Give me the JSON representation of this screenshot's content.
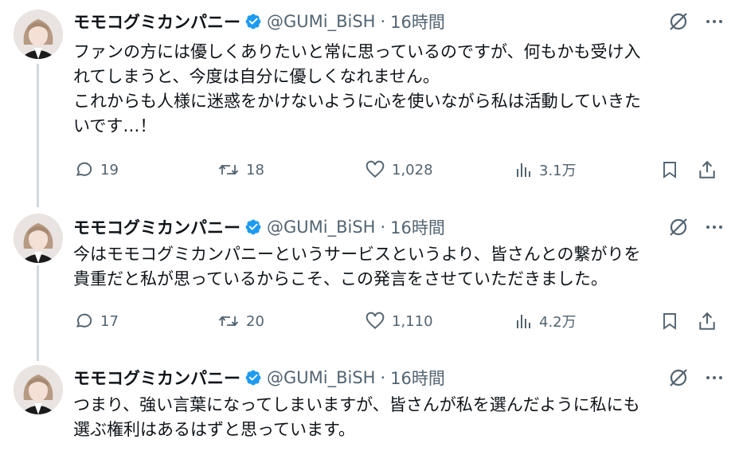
{
  "tweets": [
    {
      "name": "モモコグミカンパニー",
      "handle": "@GUMi_BiSH",
      "separator": "·",
      "time": "16時間",
      "lines": [
        "ファンの方には優しくありたいと常に思っているのですが、何もかも受け入",
        "れてしまうと、今度は自分に優しくなれません。",
        "これからも人様に迷惑をかけないように心を使いながら私は活動していきた",
        "いです…！"
      ],
      "replies": "19",
      "retweets": "18",
      "likes": "1,028",
      "views": "3.1万"
    },
    {
      "name": "モモコグミカンパニー",
      "handle": "@GUMi_BiSH",
      "separator": "·",
      "time": "16時間",
      "lines": [
        "今はモモコグミカンパニーというサービスというより、皆さんとの繋がりを",
        "貴重だと私が思っているからこそ、この発言をさせていただきました。"
      ],
      "replies": "17",
      "retweets": "20",
      "likes": "1,110",
      "views": "4.2万"
    },
    {
      "name": "モモコグミカンパニー",
      "handle": "@GUMi_BiSH",
      "separator": "·",
      "time": "16時間",
      "lines": [
        "つまり、強い言葉になってしまいますが、皆さんが私を選んだように私にも",
        "選ぶ権利はあるはずと思っています。"
      ]
    }
  ],
  "colors": {
    "text": "#0f1419",
    "secondary": "#536471",
    "verified": "#1d9bf0",
    "thread_line": "#cfd9de"
  },
  "icons": [
    "verified-badge-icon",
    "grok-icon",
    "more-icon",
    "reply-icon",
    "retweet-icon",
    "like-icon",
    "views-icon",
    "bookmark-icon",
    "share-icon"
  ]
}
